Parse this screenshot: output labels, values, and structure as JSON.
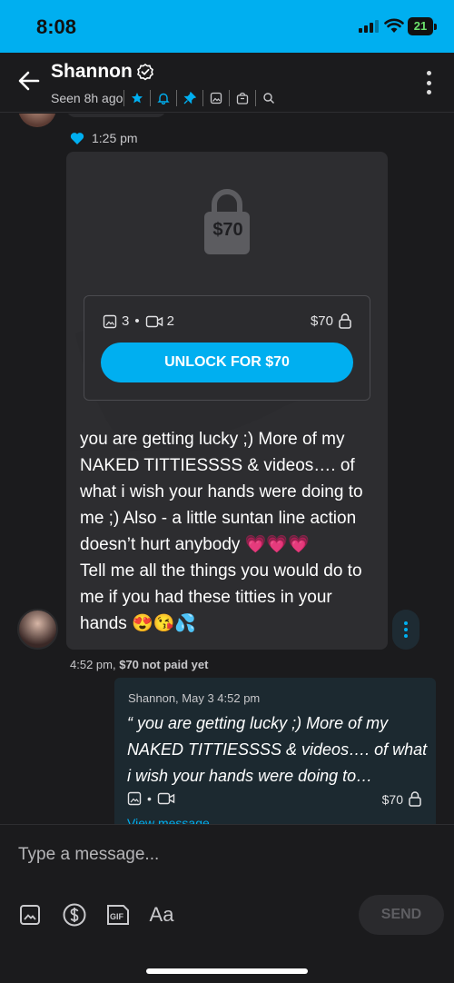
{
  "status_bar": {
    "time": "8:08",
    "battery": "21"
  },
  "header": {
    "contact_name": "Shannon",
    "seen": "Seen 8h ago",
    "icons": [
      "star-icon",
      "bell-icon",
      "pin-icon",
      "image-icon",
      "shopping-bag-icon",
      "search-icon"
    ]
  },
  "thread": {
    "liked_time": "1:25 pm",
    "locked_message": {
      "price_tag": "$70",
      "photo_count": "3",
      "video_count": "2",
      "price": "$70",
      "unlock_label": "UNLOCK FOR $70",
      "text_line1": "you are getting lucky ;) More of my NAKED TITTIESSSS & videos…. of what i wish your hands were doing to me ;) Also - a little suntan line action doesn’t hurt anybody 💗💗💗",
      "text_line2": "Tell me all the things you would do to me if you had these titties in your hands 😍😘💦",
      "time": "4:52 pm,",
      "status": "$70 not paid yet"
    },
    "reply_preview": {
      "from": "Shannon, May 3 4:52 pm",
      "quote": "“ you are getting lucky ;) More of my NAKED TITTIESSSS & videos…. of what i wish your hands were doing to…",
      "price": "$70",
      "view_label": "View message"
    }
  },
  "composer": {
    "placeholder": "Type a message...",
    "gif_label": "GIF",
    "font_label": "Aa",
    "send_label": "SEND"
  },
  "colors": {
    "accent": "#00aff0",
    "background": "#1b1b1d",
    "card": "#2d2d30",
    "reply_card": "#1c2930"
  }
}
